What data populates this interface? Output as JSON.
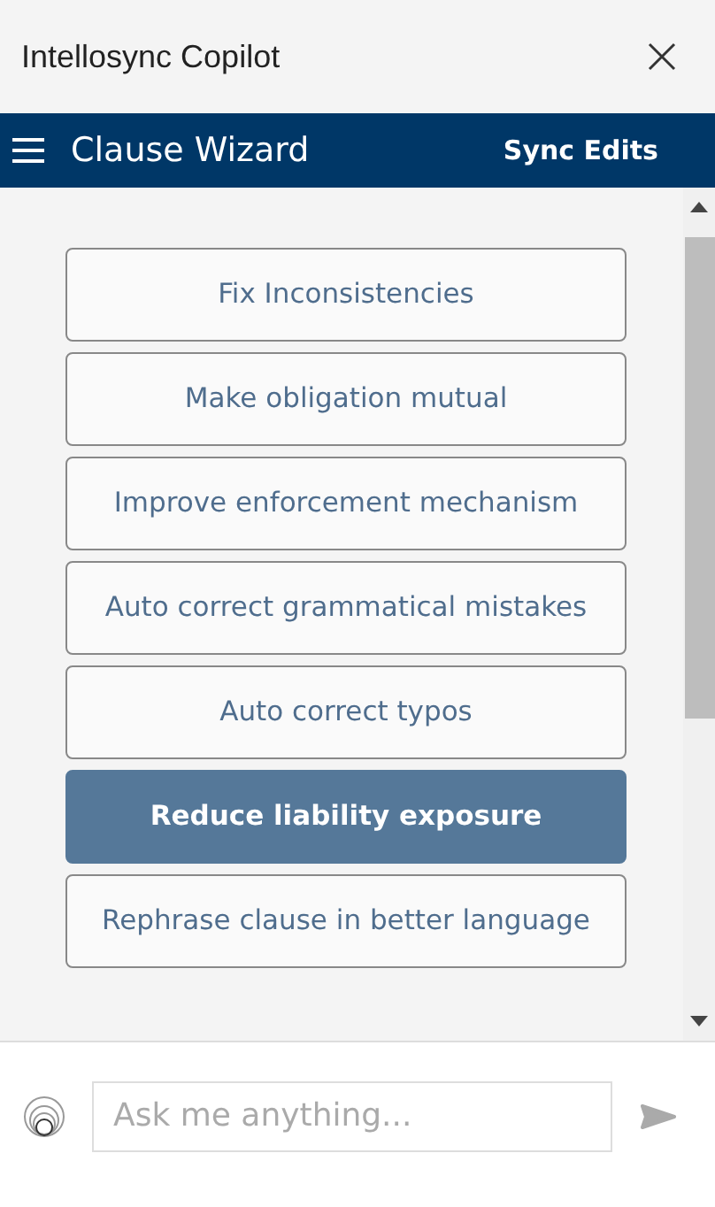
{
  "window": {
    "title": "Intellosync Copilot"
  },
  "toolbar": {
    "title": "Clause Wizard",
    "action": "Sync Edits"
  },
  "actions": [
    {
      "label": "Fix Inconsistencies",
      "selected": false
    },
    {
      "label": "Make obligation mutual",
      "selected": false
    },
    {
      "label": "Improve enforcement mechanism",
      "selected": false
    },
    {
      "label": "Auto correct grammatical mistakes",
      "selected": false
    },
    {
      "label": "Auto correct typos",
      "selected": false
    },
    {
      "label": "Reduce liability exposure",
      "selected": true
    },
    {
      "label": "Rephrase clause in better language",
      "selected": false
    }
  ],
  "composer": {
    "placeholder": "Ask me anything..."
  }
}
